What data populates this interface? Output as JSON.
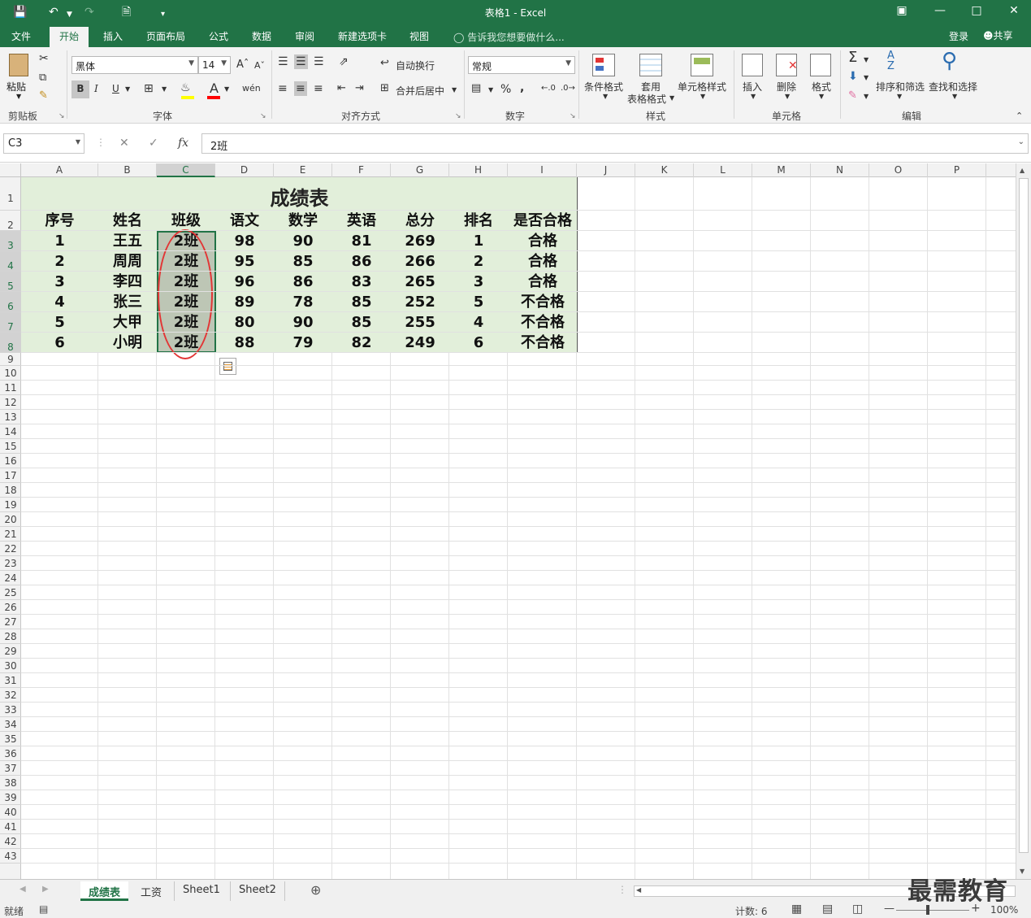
{
  "window": {
    "title": "表格1 - Excel"
  },
  "tabs": [
    {
      "label": "文件"
    },
    {
      "label": "开始"
    },
    {
      "label": "插入"
    },
    {
      "label": "页面布局"
    },
    {
      "label": "公式"
    },
    {
      "label": "数据"
    },
    {
      "label": "审阅"
    },
    {
      "label": "新建选项卡"
    },
    {
      "label": "视图"
    }
  ],
  "tellme": "告诉我您想要做什么...",
  "account": {
    "login": "登录",
    "share": "共享"
  },
  "ribbon": {
    "clipboard": {
      "paste": "粘贴",
      "label": "剪贴板"
    },
    "font": {
      "name": "黑体",
      "size": "14",
      "bold": "B",
      "italic": "I",
      "underline": "U",
      "phonetic": "wén",
      "label": "字体"
    },
    "alignment": {
      "wrap": "自动换行",
      "merge": "合并后居中",
      "label": "对齐方式"
    },
    "number": {
      "format": "常规",
      "percent": "%",
      "comma": ",",
      "label": "数字"
    },
    "styles": {
      "conditional": "条件格式",
      "table1": "套用",
      "table2": "表格格式",
      "cell_styles": "单元格样式",
      "label": "样式"
    },
    "cells": {
      "insert": "插入",
      "delete": "删除",
      "format": "格式",
      "label": "单元格"
    },
    "editing": {
      "sort": "排序和筛选",
      "find": "查找和选择",
      "label": "编辑"
    }
  },
  "formula_bar": {
    "name_box": "C3",
    "fx": "fx",
    "content": "2班"
  },
  "columns": [
    "A",
    "B",
    "C",
    "D",
    "E",
    "F",
    "G",
    "H",
    "I",
    "J",
    "K",
    "L",
    "M",
    "N",
    "O",
    "P"
  ],
  "rows": [
    "1",
    "2",
    "3",
    "4",
    "5",
    "6",
    "7",
    "8",
    "9",
    "10",
    "11",
    "12",
    "13",
    "14",
    "15",
    "16",
    "17",
    "18",
    "19",
    "20",
    "21",
    "22",
    "23",
    "24",
    "25",
    "26",
    "27",
    "28",
    "29",
    "30",
    "31",
    "32",
    "33",
    "34",
    "35",
    "36",
    "37",
    "38",
    "39",
    "40",
    "41",
    "42",
    "43"
  ],
  "sheet": {
    "title": "成绩表",
    "headers": [
      "序号",
      "姓名",
      "班级",
      "语文",
      "数学",
      "英语",
      "总分",
      "排名",
      "是否合格"
    ],
    "data": [
      [
        "1",
        "王五",
        "2班",
        "98",
        "90",
        "81",
        "269",
        "1",
        "合格"
      ],
      [
        "2",
        "周周",
        "2班",
        "95",
        "85",
        "86",
        "266",
        "2",
        "合格"
      ],
      [
        "3",
        "李四",
        "2班",
        "96",
        "86",
        "83",
        "265",
        "3",
        "合格"
      ],
      [
        "4",
        "张三",
        "2班",
        "89",
        "78",
        "85",
        "252",
        "5",
        "不合格"
      ],
      [
        "5",
        "大甲",
        "2班",
        "80",
        "90",
        "85",
        "255",
        "4",
        "不合格"
      ],
      [
        "6",
        "小明",
        "2班",
        "88",
        "79",
        "82",
        "249",
        "6",
        "不合格"
      ]
    ]
  },
  "sheet_tabs": [
    {
      "label": "成绩表"
    },
    {
      "label": "工资"
    },
    {
      "label": "Sheet1"
    },
    {
      "label": "Sheet2"
    }
  ],
  "status": {
    "ready": "就绪",
    "count": "计数: 6",
    "zoom": "100%"
  },
  "watermark": "最需教育",
  "colors": {
    "accent": "#217346",
    "table_fill": "#e2efda",
    "oval": "#e23535"
  }
}
